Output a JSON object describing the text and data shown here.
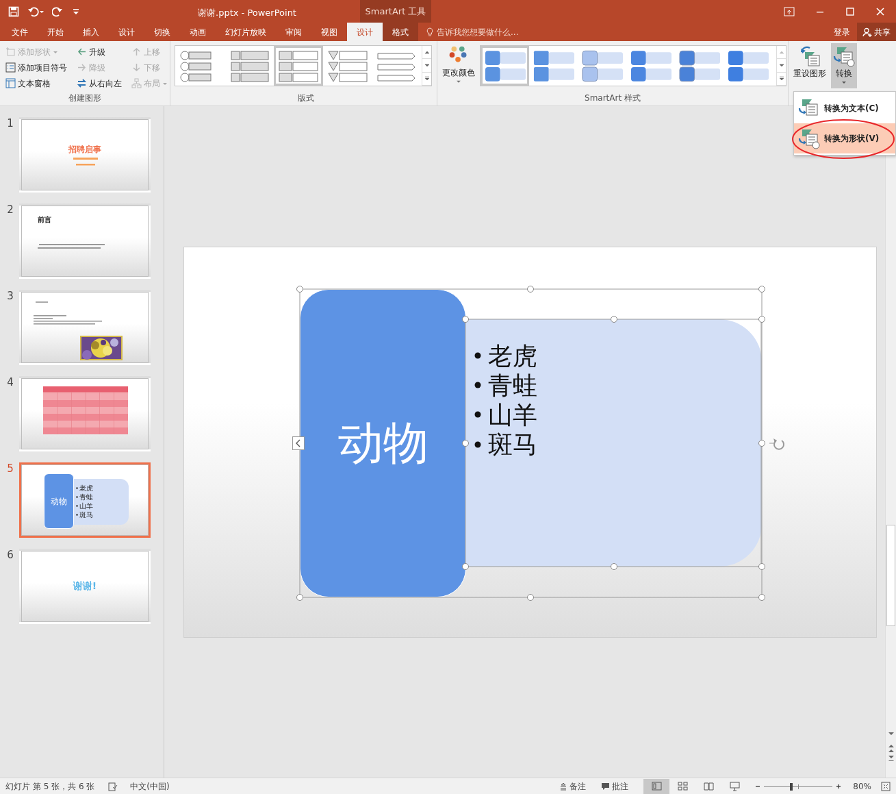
{
  "app": {
    "title": "谢谢.pptx - PowerPoint",
    "context_label": "SmartArt 工具"
  },
  "tabs": [
    {
      "label": "文件",
      "selected": false,
      "contextual": false
    },
    {
      "label": "开始",
      "selected": false,
      "contextual": false
    },
    {
      "label": "插入",
      "selected": false,
      "contextual": false
    },
    {
      "label": "设计",
      "selected": false,
      "contextual": false
    },
    {
      "label": "切换",
      "selected": false,
      "contextual": false
    },
    {
      "label": "动画",
      "selected": false,
      "contextual": false
    },
    {
      "label": "幻灯片放映",
      "selected": false,
      "contextual": false
    },
    {
      "label": "审阅",
      "selected": false,
      "contextual": false
    },
    {
      "label": "视图",
      "selected": false,
      "contextual": false
    },
    {
      "label": "设计",
      "selected": true,
      "contextual": true
    },
    {
      "label": "格式",
      "selected": false,
      "contextual": true
    }
  ],
  "tell_me": {
    "placeholder": "告诉我您想要做什么..."
  },
  "account": {
    "sign_in": "登录",
    "share": "共享"
  },
  "create_group": {
    "label": "创建图形",
    "commands": [
      {
        "label": "添加形状",
        "disabled": true,
        "dropdown": true
      },
      {
        "label": "添加项目符号",
        "disabled": false,
        "dropdown": false
      },
      {
        "label": "文本窗格",
        "disabled": false,
        "dropdown": false
      },
      {
        "label": "升级",
        "disabled": false,
        "dropdown": false
      },
      {
        "label": "降级",
        "disabled": true,
        "dropdown": false
      },
      {
        "label": "从右向左",
        "disabled": false,
        "dropdown": false
      },
      {
        "label": "上移",
        "disabled": true,
        "dropdown": false
      },
      {
        "label": "下移",
        "disabled": true,
        "dropdown": false
      },
      {
        "label": "布局",
        "disabled": true,
        "dropdown": true
      }
    ]
  },
  "layout_group": {
    "label": "版式",
    "layouts": [
      {
        "selected": false
      },
      {
        "selected": false
      },
      {
        "selected": true
      },
      {
        "selected": false
      },
      {
        "selected": false
      }
    ]
  },
  "styles_group": {
    "label": "SmartArt 样式",
    "change_colors": "更改颜色",
    "styles": [
      {
        "selected": true
      },
      {
        "selected": false
      },
      {
        "selected": false
      },
      {
        "selected": false
      },
      {
        "selected": false
      },
      {
        "selected": false
      }
    ]
  },
  "reset_button": {
    "label": "重设图形"
  },
  "convert": {
    "label": "转换",
    "pressed": true
  },
  "convert_menu": [
    {
      "label": "转换为文本(C)",
      "kind": "text",
      "selected": false
    },
    {
      "label": "转换为形状(V)",
      "kind": "shape",
      "selected": true
    }
  ],
  "slides": [
    {
      "number": "1",
      "kind": "title",
      "selected": false,
      "title": "招聘启事"
    },
    {
      "number": "2",
      "kind": "heading",
      "selected": false,
      "title": "前言"
    },
    {
      "number": "3",
      "kind": "text-picture",
      "selected": false
    },
    {
      "number": "4",
      "kind": "table",
      "selected": false
    },
    {
      "number": "5",
      "kind": "smartart",
      "selected": true,
      "title": "动物",
      "items": [
        "老虎",
        "青蛙",
        "山羊",
        "斑马"
      ]
    },
    {
      "number": "6",
      "kind": "closing",
      "selected": false,
      "title": "谢谢!"
    }
  ],
  "smartart": {
    "title": "动物",
    "items": [
      "老虎",
      "青蛙",
      "山羊",
      "斑马"
    ]
  },
  "status_bar": {
    "slide_info": "幻灯片 第 5 张，共 6 张",
    "language": "中文(中国)",
    "notes": "备注",
    "comments": "批注",
    "views": [
      {
        "selected": true
      },
      {
        "selected": false
      },
      {
        "selected": false
      },
      {
        "selected": false
      }
    ],
    "zoom_slider": {
      "level": 0.4
    },
    "zoom": "80%"
  }
}
